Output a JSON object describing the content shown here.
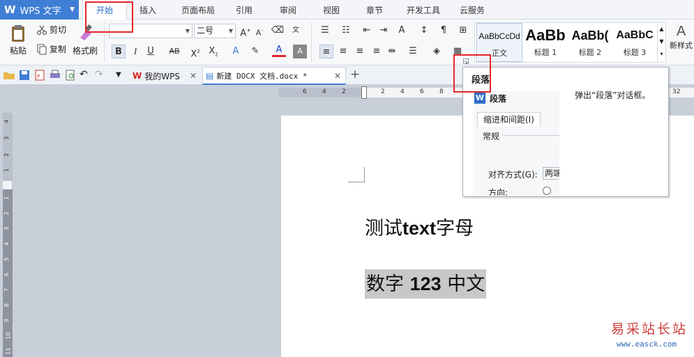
{
  "app": {
    "name": "WPS 文字"
  },
  "menu": {
    "tabs": [
      "开始",
      "插入",
      "页面布局",
      "引用",
      "审阅",
      "视图",
      "章节",
      "开发工具",
      "云服务"
    ],
    "active_tab": "开始"
  },
  "ribbon": {
    "clipboard": {
      "paste": "粘贴",
      "cut": "剪切",
      "copy": "复制",
      "format_painter": "格式刷"
    },
    "font": {
      "name": "",
      "size": "二号"
    },
    "styles": [
      {
        "sample": "AaBbCcDd",
        "name": "正文",
        "selected": true
      },
      {
        "sample": "AaBb",
        "name": "标题 1",
        "selected": false
      },
      {
        "sample": "AaBb(",
        "name": "标题 2",
        "selected": false
      },
      {
        "sample": "AaBbC",
        "name": "标题 3",
        "selected": false
      }
    ],
    "new_style": "新样式"
  },
  "quickbar": {
    "doc_tabs": [
      {
        "label": "我的WPS",
        "active": false
      },
      {
        "label": "新建 DOCX 文档.docx *",
        "active": true
      }
    ],
    "new_tab": "+"
  },
  "ruler": {
    "h_ticks": [
      "6",
      "4",
      "2",
      "2",
      "4",
      "6",
      "8",
      "32"
    ],
    "v_ticks": [
      "4",
      "3",
      "2",
      "1",
      "1",
      "2",
      "3",
      "4",
      "5",
      "6",
      "7",
      "8",
      "9",
      "10",
      "11"
    ]
  },
  "document": {
    "line1_a": "测试",
    "line1_b": "text",
    "line1_c": "字母",
    "line2_a": "数字 ",
    "line2_b": "123",
    "line2_c": " 中文"
  },
  "tooltip": {
    "title": "段落",
    "description": "弹出“段落”对话框。",
    "preview": {
      "dialog_title": "段落",
      "tab": "缩进和间距(I)",
      "section": "常规",
      "align_label": "对齐方式(G):",
      "align_value": "两端",
      "direction_label": "方向:"
    }
  },
  "watermark": {
    "cn": "易采站长站",
    "url": "www.easck.com"
  },
  "colors": {
    "accent": "#3f7ed5",
    "highlight": "#e5262a",
    "selection": "#c8c8c8"
  }
}
